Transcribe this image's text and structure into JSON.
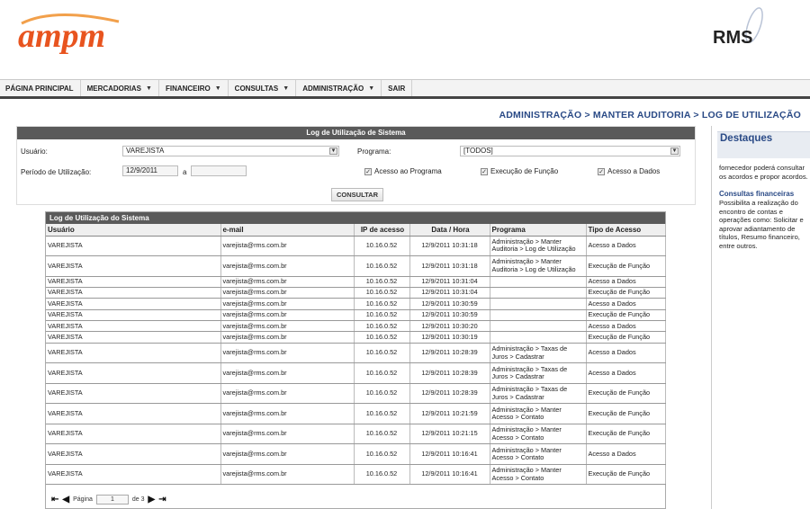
{
  "header": {
    "logo_left": "ampm",
    "logo_right": "RMS"
  },
  "nav": {
    "items": [
      {
        "label": "PÁGINA PRINCIPAL",
        "dropdown": false
      },
      {
        "label": "MERCADORIAS",
        "dropdown": true
      },
      {
        "label": "FINANCEIRO",
        "dropdown": true
      },
      {
        "label": "CONSULTAS",
        "dropdown": true
      },
      {
        "label": "ADMINISTRAÇÃO",
        "dropdown": true
      },
      {
        "label": "SAIR",
        "dropdown": false
      }
    ]
  },
  "breadcrumb": "ADMINISTRAÇÃO > MANTER AUDITORIA > LOG DE UTILIZAÇÃO",
  "filter": {
    "title": "Log de Utilização de Sistema",
    "usuario_label": "Usuário:",
    "usuario_value": "VAREJISTA",
    "programa_label": "Programa:",
    "programa_value": "[TODOS]",
    "periodo_label": "Período de Utilização:",
    "periodo_start": "12/9/2011",
    "periodo_sep": "a",
    "periodo_end": "",
    "checkboxes": [
      {
        "label": "Acesso ao Programa",
        "checked": true
      },
      {
        "label": "Execução de Função",
        "checked": true
      },
      {
        "label": "Acesso a Dados",
        "checked": true
      }
    ],
    "button": "CONSULTAR"
  },
  "log": {
    "title": "Log de Utilização do Sistema",
    "columns": [
      "Usuário",
      "e-mail",
      "IP de acesso",
      "Data / Hora",
      "Programa",
      "Tipo de Acesso"
    ],
    "rows": [
      {
        "usuario": "VAREJISTA",
        "email": "varejista@rms.com.br",
        "ip": "10.16.0.52",
        "data": "12/9/2011 10:31:18",
        "programa": "Administração > Manter Auditoria > Log de Utilização",
        "tipo": "Acesso a Dados",
        "tall": true
      },
      {
        "usuario": "VAREJISTA",
        "email": "varejista@rms.com.br",
        "ip": "10.16.0.52",
        "data": "12/9/2011 10:31:18",
        "programa": "Administração > Manter Auditoria > Log de Utilização",
        "tipo": "Execução de Função",
        "tall": true
      },
      {
        "usuario": "VAREJISTA",
        "email": "varejista@rms.com.br",
        "ip": "10.16.0.52",
        "data": "12/9/2011 10:31:04",
        "programa": "",
        "tipo": "Acesso a Dados",
        "tall": false
      },
      {
        "usuario": "VAREJISTA",
        "email": "varejista@rms.com.br",
        "ip": "10.16.0.52",
        "data": "12/9/2011 10:31:04",
        "programa": "",
        "tipo": "Execução de Função",
        "tall": false
      },
      {
        "usuario": "VAREJISTA",
        "email": "varejista@rms.com.br",
        "ip": "10.16.0.52",
        "data": "12/9/2011 10:30:59",
        "programa": "",
        "tipo": "Acesso a Dados",
        "tall": false
      },
      {
        "usuario": "VAREJISTA",
        "email": "varejista@rms.com.br",
        "ip": "10.16.0.52",
        "data": "12/9/2011 10:30:59",
        "programa": "",
        "tipo": "Execução de Função",
        "tall": false
      },
      {
        "usuario": "VAREJISTA",
        "email": "varejista@rms.com.br",
        "ip": "10.16.0.52",
        "data": "12/9/2011 10:30:20",
        "programa": "",
        "tipo": "Acesso a Dados",
        "tall": false
      },
      {
        "usuario": "VAREJISTA",
        "email": "varejista@rms.com.br",
        "ip": "10.16.0.52",
        "data": "12/9/2011 10:30:19",
        "programa": "",
        "tipo": "Execução de Função",
        "tall": false
      },
      {
        "usuario": "VAREJISTA",
        "email": "varejista@rms.com.br",
        "ip": "10.16.0.52",
        "data": "12/9/2011 10:28:39",
        "programa": "Administração > Taxas de Juros > Cadastrar",
        "tipo": "Acesso a Dados",
        "tall": true
      },
      {
        "usuario": "VAREJISTA",
        "email": "varejista@rms.com.br",
        "ip": "10.16.0.52",
        "data": "12/9/2011 10:28:39",
        "programa": "Administração > Taxas de Juros > Cadastrar",
        "tipo": "Acesso a Dados",
        "tall": true
      },
      {
        "usuario": "VAREJISTA",
        "email": "varejista@rms.com.br",
        "ip": "10.16.0.52",
        "data": "12/9/2011 10:28:39",
        "programa": "Administração > Taxas de Juros > Cadastrar",
        "tipo": "Execução de Função",
        "tall": true
      },
      {
        "usuario": "VAREJISTA",
        "email": "varejista@rms.com.br",
        "ip": "10.16.0.52",
        "data": "12/9/2011 10:21:59",
        "programa": "Administração > Manter Acesso > Contato",
        "tipo": "Execução de Função",
        "tall": true
      },
      {
        "usuario": "VAREJISTA",
        "email": "varejista@rms.com.br",
        "ip": "10.16.0.52",
        "data": "12/9/2011 10:21:15",
        "programa": "Administração > Manter Acesso > Contato",
        "tipo": "Execução de Função",
        "tall": true
      },
      {
        "usuario": "VAREJISTA",
        "email": "varejista@rms.com.br",
        "ip": "10.16.0.52",
        "data": "12/9/2011 10:16:41",
        "programa": "Administração > Manter Acesso > Contato",
        "tipo": "Acesso a Dados",
        "tall": true
      },
      {
        "usuario": "VAREJISTA",
        "email": "varejista@rms.com.br",
        "ip": "10.16.0.52",
        "data": "12/9/2011 10:16:41",
        "programa": "Administração > Manter Acesso > Contato",
        "tipo": "Execução de Função",
        "tall": true
      }
    ],
    "pager": {
      "label": "Página",
      "current": "1",
      "of": "de 3"
    }
  },
  "sidebar": {
    "title": "Destaques",
    "text1": "fornecedor poderá consultar os acordos e propor acordos.",
    "head2": "Consultas financeiras",
    "text2": "Possibilita a realização do encontro de contas e operações como: Solicitar e aprovar adiantamento de títulos, Resumo financeiro, entre outros."
  },
  "colors": {
    "logo_orange": "#e8541f",
    "logo_blue": "#2a4a86",
    "nav_bar": "#444444",
    "panel_header": "#5a5a5a",
    "link_blue": "#2a4a86"
  }
}
